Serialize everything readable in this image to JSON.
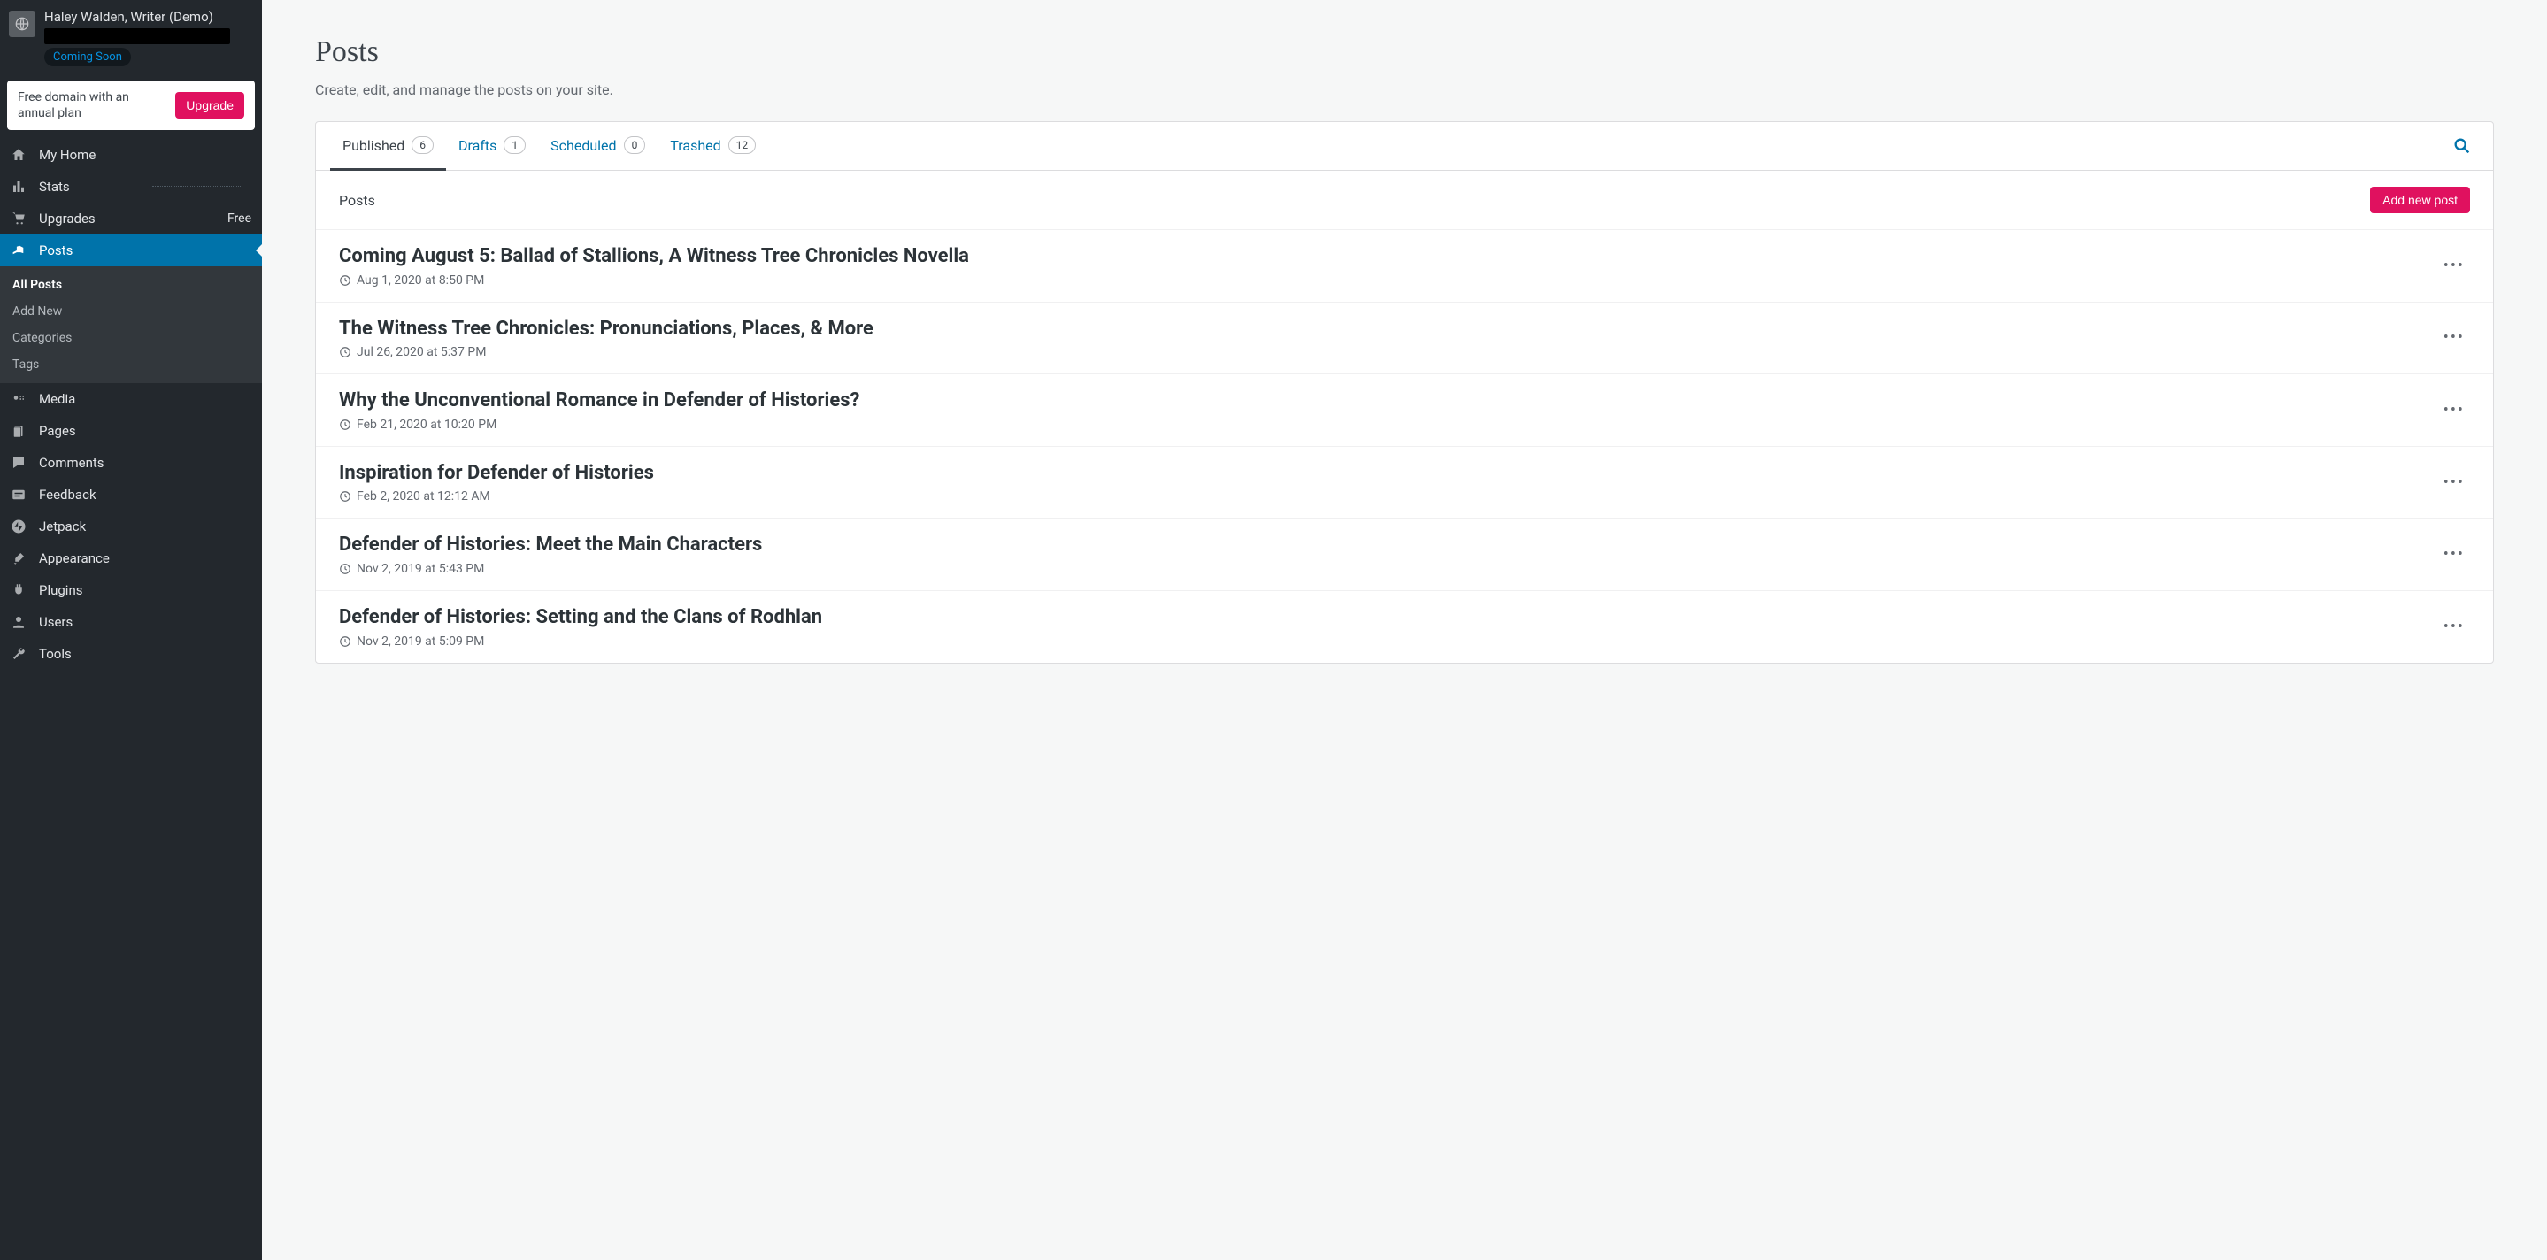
{
  "site": {
    "title": "Haley Walden, Writer (Demo)",
    "status_label": "Coming Soon"
  },
  "promo": {
    "text": "Free domain with an annual plan",
    "cta": "Upgrade"
  },
  "sidebar": {
    "items": [
      {
        "icon": "home",
        "label": "My Home"
      },
      {
        "icon": "stats",
        "label": "Stats",
        "separator_after": true
      },
      {
        "icon": "cart",
        "label": "Upgrades",
        "right": "Free"
      },
      {
        "icon": "pin",
        "label": "Posts",
        "active": true
      },
      {
        "icon": "media",
        "label": "Media"
      },
      {
        "icon": "pages",
        "label": "Pages"
      },
      {
        "icon": "comment",
        "label": "Comments"
      },
      {
        "icon": "feedback",
        "label": "Feedback"
      },
      {
        "icon": "jetpack",
        "label": "Jetpack"
      },
      {
        "icon": "brush",
        "label": "Appearance"
      },
      {
        "icon": "plug",
        "label": "Plugins"
      },
      {
        "icon": "user",
        "label": "Users"
      },
      {
        "icon": "wrench",
        "label": "Tools"
      }
    ],
    "posts_submenu": [
      {
        "label": "All Posts",
        "current": true
      },
      {
        "label": "Add New"
      },
      {
        "label": "Categories"
      },
      {
        "label": "Tags"
      }
    ]
  },
  "page": {
    "title": "Posts",
    "description": "Create, edit, and manage the posts on your site."
  },
  "tabs": [
    {
      "label": "Published",
      "count": "6",
      "active": true
    },
    {
      "label": "Drafts",
      "count": "1",
      "active": false
    },
    {
      "label": "Scheduled",
      "count": "0",
      "active": false
    },
    {
      "label": "Trashed",
      "count": "12",
      "active": false
    }
  ],
  "list": {
    "header_label": "Posts",
    "add_button": "Add new post"
  },
  "posts": [
    {
      "title": "Coming August 5: Ballad of Stallions, A Witness Tree Chronicles Novella",
      "date": "Aug 1, 2020 at 8:50 PM"
    },
    {
      "title": "The Witness Tree Chronicles: Pronunciations, Places, & More",
      "date": "Jul 26, 2020 at 5:37 PM"
    },
    {
      "title": "Why the Unconventional Romance in Defender of Histories?",
      "date": "Feb 21, 2020 at 10:20 PM"
    },
    {
      "title": "Inspiration for Defender of Histories",
      "date": "Feb 2, 2020 at 12:12 AM"
    },
    {
      "title": "Defender of Histories: Meet the Main Characters",
      "date": "Nov 2, 2019 at 5:43 PM"
    },
    {
      "title": "Defender of Histories: Setting and the Clans of Rodhlan",
      "date": "Nov 2, 2019 at 5:09 PM"
    }
  ]
}
